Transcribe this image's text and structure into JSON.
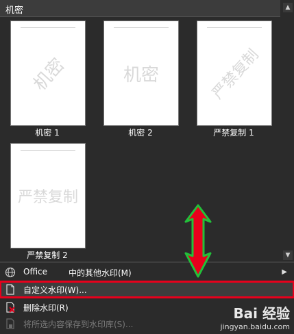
{
  "header": {
    "title": "机密"
  },
  "gallery": {
    "tiles": [
      {
        "watermark": "机密",
        "caption": "机密 1",
        "style": "diagonal"
      },
      {
        "watermark": "机密",
        "caption": "机密 2",
        "style": "horizontal"
      },
      {
        "watermark": "严禁复制",
        "caption": "严禁复制 1",
        "style": "diagonal"
      },
      {
        "watermark": "严禁复制",
        "caption": "严禁复制 2",
        "style": "horizontal"
      }
    ]
  },
  "menu": {
    "office_label": "Office",
    "office_more": "中的其他水印(M)",
    "custom": "自定义水印(W)...",
    "remove": "删除水印(R)",
    "save": "将所选内容保存到水印库(S)..."
  },
  "overlay": {
    "brand_top": "Bai 经验",
    "brand_url": "jingyan.baidu.com"
  },
  "colors": {
    "highlight_border": "#e8001c",
    "arrow_fill": "#e8001c",
    "arrow_stroke": "#22c13a"
  }
}
